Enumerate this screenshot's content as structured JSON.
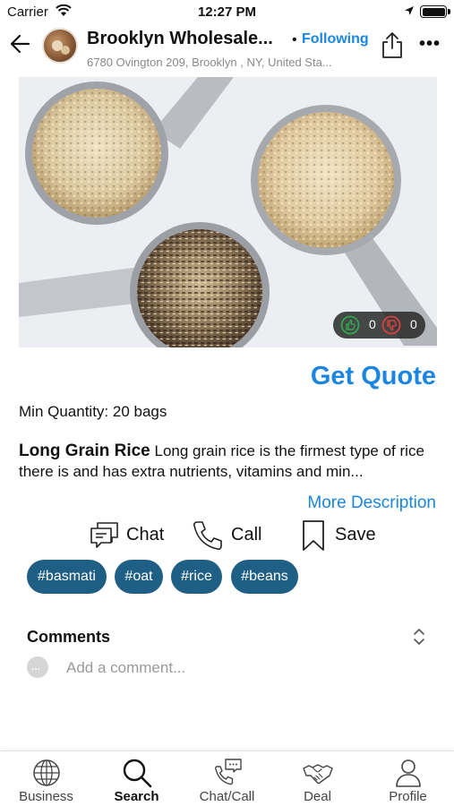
{
  "status_bar": {
    "carrier": "Carrier",
    "time": "12:27 PM"
  },
  "header": {
    "business_name": "Brooklyn Wholesale...",
    "follow_separator": "•",
    "follow_label": "Following",
    "address": "6780 Ovington 209, Brooklyn , NY, United Sta..."
  },
  "product": {
    "likes": "0",
    "dislikes": "0",
    "get_quote_label": "Get Quote",
    "min_quantity": "Min Quantity: 20 bags",
    "title": "Long Grain Rice",
    "description": "Long grain rice is the firmest type of rice there is and has extra nutrients, vitamins and min...",
    "more_description_label": "More Description"
  },
  "actions": {
    "chat": "Chat",
    "call": "Call",
    "save": "Save"
  },
  "tags": [
    "#basmati",
    "#oat",
    "#rice",
    "#beans"
  ],
  "comments": {
    "title": "Comments",
    "avatar_text": "...",
    "placeholder": "Add a comment..."
  },
  "tab_bar": {
    "active": "Search",
    "tabs": [
      "Business",
      "Search",
      "Chat/Call",
      "Deal",
      "Profile"
    ]
  },
  "colors": {
    "accent": "#1a86e0",
    "tag_background": "#1f5f86",
    "like": "#2fa84f",
    "dislike": "#d9413a"
  }
}
